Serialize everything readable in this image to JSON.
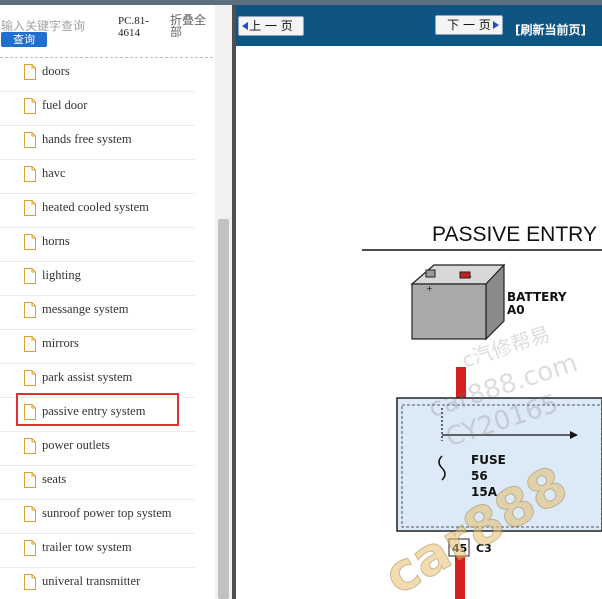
{
  "search": {
    "placeholder": "输入关键字查询",
    "button_label": "查询",
    "doc_code": "PC.81-4614",
    "collapse_label": "折叠全部"
  },
  "tree": {
    "items": [
      {
        "label": "doors"
      },
      {
        "label": "fuel door"
      },
      {
        "label": "hands free system"
      },
      {
        "label": "havc"
      },
      {
        "label": "heated cooled system"
      },
      {
        "label": "horns"
      },
      {
        "label": "lighting"
      },
      {
        "label": "messange system"
      },
      {
        "label": "mirrors"
      },
      {
        "label": "park assist system"
      },
      {
        "label": "passive entry system"
      },
      {
        "label": "power outlets"
      },
      {
        "label": "seats"
      },
      {
        "label": "sunroof power top system"
      },
      {
        "label": "trailer tow system"
      },
      {
        "label": "univeral transmitter"
      }
    ],
    "selected_label": "passive entry system"
  },
  "toolbar": {
    "prev_label": "上 一 页",
    "next_label": "下 一 页",
    "refresh_label": "[刷新当前页]",
    "bg_color": "#0f5584"
  },
  "diagram": {
    "title": "PASSIVE ENTRY",
    "battery_label": "BATTERY",
    "battery_id": "A0",
    "fuse_label": "FUSE",
    "fuse_number": "56",
    "fuse_rating": "15A",
    "connector_pin": "45",
    "connector_id": "C3",
    "wire_color": "#d42020",
    "box_fill": "#dce9f6"
  },
  "watermark": {
    "line1": "c汽修帮易",
    "line2": "car888.com",
    "line3": "CY20165",
    "big": "car888"
  }
}
